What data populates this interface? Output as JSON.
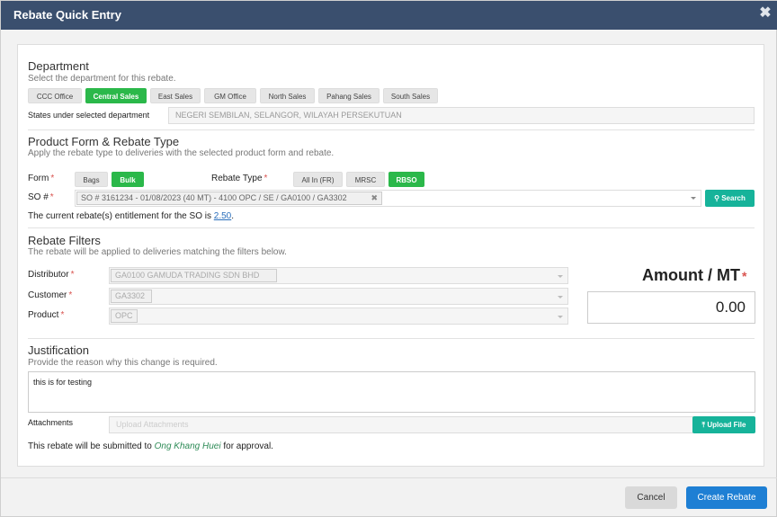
{
  "window": {
    "title": "Rebate Quick Entry",
    "close_glyph": "✖"
  },
  "department": {
    "heading": "Department",
    "subtitle": "Select the department for this rebate.",
    "options": [
      "CCC Office",
      "Central Sales",
      "East Sales",
      "GM Office",
      "North Sales",
      "Pahang Sales",
      "South Sales"
    ],
    "selected": "Central Sales",
    "states_label": "States under selected department",
    "states_value": "NEGERI SEMBILAN, SELANGOR, WILAYAH PERSEKUTUAN"
  },
  "product_form": {
    "heading": "Product Form & Rebate Type",
    "subtitle": "Apply the rebate type to deliveries with the selected product form and rebate.",
    "form_label": "Form",
    "form_options": [
      "Bags",
      "Bulk"
    ],
    "form_selected": "Bulk",
    "rebate_type_label": "Rebate Type",
    "rebate_type_options": [
      "All In (FR)",
      "MRSC",
      "RBSO"
    ],
    "rebate_type_selected": "RBSO",
    "so_label": "SO #",
    "so_value": "SO # 3161234 - 01/08/2023 (40 MT) - 4100 OPC / SE / GA0100 / GA3302",
    "search_label": "Search",
    "entitlement_text": "The current rebate(s) entitlement for the SO is",
    "entitlement_value": "2.50",
    "entitlement_end": "."
  },
  "filters": {
    "heading": "Rebate Filters",
    "subtitle": "The rebate will be applied to deliveries matching the filters below.",
    "distributor_label": "Distributor",
    "distributor_value": "GA0100 GAMUDA TRADING SDN BHD",
    "customer_label": "Customer",
    "customer_value": "GA3302",
    "product_label": "Product",
    "product_value": "OPC",
    "amount_label": "Amount / MT",
    "amount_value": "0.00"
  },
  "justification": {
    "heading": "Justification",
    "subtitle": "Provide the reason why this change is required.",
    "text": "this is for testing",
    "attachments_label": "Attachments",
    "attachments_placeholder": "Upload Attachments",
    "upload_label": "Upload File",
    "approval_prefix": "This rebate will be submitted to",
    "approver": "Ong Khang Huei",
    "approval_suffix": "for approval."
  },
  "footer": {
    "cancel_label": "Cancel",
    "create_label": "Create Rebate"
  },
  "colors": {
    "titlebar": "#3a4f6e",
    "active": "#2bb84a",
    "teal": "#16b39a",
    "primary": "#1e7fd4"
  }
}
